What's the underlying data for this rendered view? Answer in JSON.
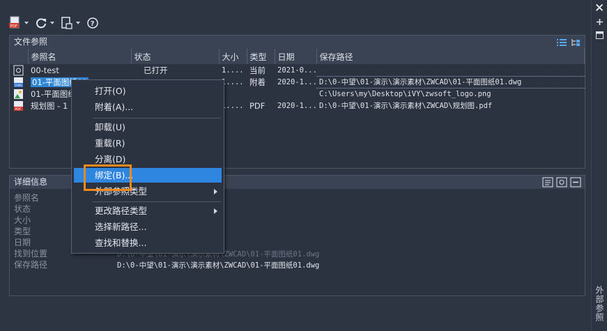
{
  "toolbar": {
    "attach_icon": "pdf-attach-icon",
    "refresh_icon": "refresh-icon",
    "change_path_icon": "change-path-icon",
    "help_icon": "help-icon"
  },
  "side": {
    "close": "✕",
    "label": "外部参照"
  },
  "refs_panel": {
    "title": "文件参照",
    "columns": [
      "参照名",
      "状态",
      "大小",
      "类型",
      "日期",
      "保存路径"
    ],
    "rows": [
      {
        "name": "00-test",
        "status": "已打开",
        "size": "1....",
        "type": "当前",
        "date": "2021-0...",
        "path": "",
        "icon": "dwg-current-icon"
      },
      {
        "name": "01-平面图纸01",
        "status": "",
        "size": "1....",
        "type": "附着",
        "date": "2020-1...",
        "path": "D:\\0-中望\\01-演示\\演示素材\\ZWCAD\\01-平面图纸01.dwg",
        "icon": "dwg-ref-icon"
      },
      {
        "name": "01-平面图纸",
        "status": "",
        "size": "",
        "type": "",
        "date": "",
        "path": "C:\\Users\\my\\Desktop\\iVY\\zwsoft_logo.png",
        "icon": "image-ref-icon"
      },
      {
        "name": "规划图 - 1",
        "status": "",
        "size": "1....",
        "type": "PDF",
        "date": "2020-1...",
        "path": "D:\\0-中望\\01-演示\\演示素材\\ZWCAD\\规划图.pdf",
        "icon": "pdf-ref-icon"
      }
    ]
  },
  "details_panel": {
    "title": "详细信息",
    "labels": [
      "参照名",
      "状态",
      "大小",
      "类型",
      "日期",
      "找到位置",
      "保存路径"
    ],
    "found_at": "D:\\0-中望\\01-演示\\演示素材\\ZWCAD\\01-平面图纸01.dwg",
    "saved_path": "D:\\0-中望\\01-演示\\演示素材\\ZWCAD\\01-平面图纸01.dwg"
  },
  "context_menu": {
    "items": [
      "打开(O)",
      "附着(A)...",
      "卸载(U)",
      "重载(R)",
      "分离(D)",
      "绑定(B)...",
      "外部参照类型",
      "更改路径类型",
      "选择新路径...",
      "查找和替换..."
    ],
    "highlighted": "绑定(B)..."
  },
  "colors": {
    "background": "#2d3543",
    "highlight": "#2f86e0",
    "callout": "#f08a1c"
  }
}
